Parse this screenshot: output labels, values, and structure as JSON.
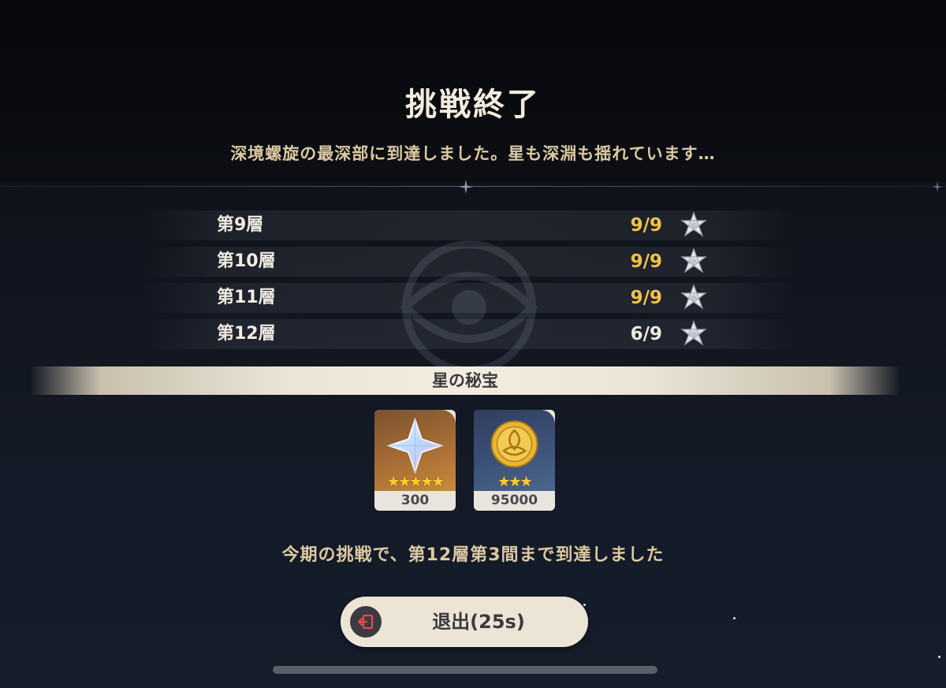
{
  "header": {
    "title": "挑戦終了",
    "subtitle": "深境螺旋の最深部に到達しました。星も深淵も揺れています…"
  },
  "floors": [
    {
      "label": "第9層",
      "score": "9/9",
      "complete": true
    },
    {
      "label": "第10層",
      "score": "9/9",
      "complete": true
    },
    {
      "label": "第11層",
      "score": "9/9",
      "complete": true
    },
    {
      "label": "第12層",
      "score": "6/9",
      "complete": false
    }
  ],
  "colors": {
    "score_complete": "#f3c24b",
    "score_partial": "#eeeae0",
    "title_text": "#f2ecdd",
    "accent_text": "#dcc9a0",
    "rarity_star": "#ffcc33"
  },
  "treasure": {
    "label": "星の秘宝",
    "items": [
      {
        "icon": "primogem-icon",
        "rarity": 5,
        "count": "300"
      },
      {
        "icon": "mora-coin-icon",
        "rarity": 3,
        "count": "95000"
      }
    ]
  },
  "progress_text": "今期の挑戦で、第12層第3間まで到達しました",
  "exit_button": {
    "icon": "exit-door-icon",
    "label": "退出(25s)"
  }
}
